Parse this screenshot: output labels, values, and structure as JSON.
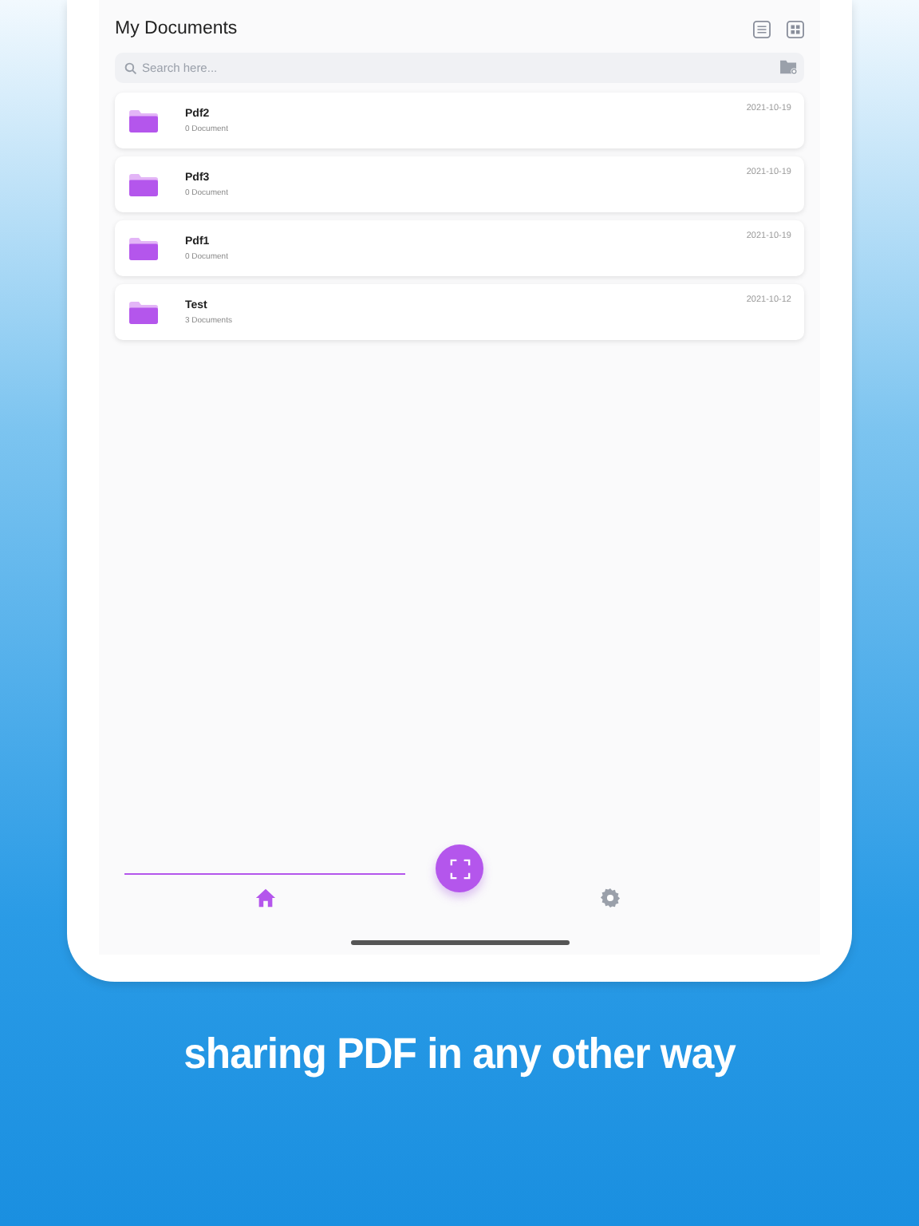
{
  "header": {
    "title": "My Documents"
  },
  "search": {
    "placeholder": "Search here..."
  },
  "folders": [
    {
      "name": "Pdf2",
      "count": "0 Document",
      "date": "2021-10-19"
    },
    {
      "name": "Pdf3",
      "count": "0 Document",
      "date": "2021-10-19"
    },
    {
      "name": "Pdf1",
      "count": "0 Document",
      "date": "2021-10-19"
    },
    {
      "name": "Test",
      "count": "3 Documents",
      "date": "2021-10-12"
    }
  ],
  "tabs": [
    {
      "kind": "home",
      "selected": true
    },
    {
      "kind": "settings",
      "selected": false
    }
  ],
  "caption": "sharing PDF in any other way"
}
